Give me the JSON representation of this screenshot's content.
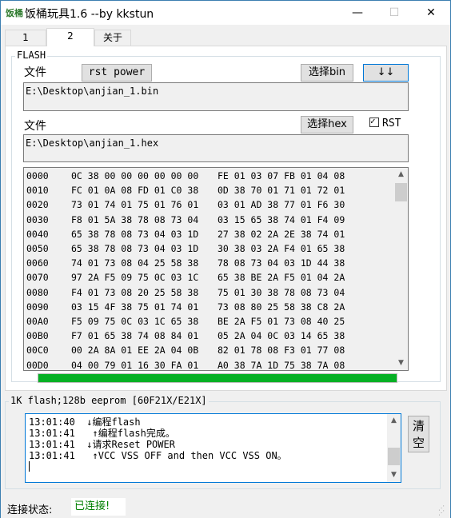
{
  "window": {
    "icon_label": "饭桶",
    "title": "饭桶玩具1.6    --by kkstun",
    "minimize": "—",
    "maximize": "☐",
    "close": "✕"
  },
  "tabs": [
    {
      "label": "1"
    },
    {
      "label": "2"
    },
    {
      "label": "关于"
    }
  ],
  "flash": {
    "group_label": "FLASH",
    "file_label_1": "文件",
    "file_label_2": "文件",
    "rst_power_button": "rst power",
    "select_bin_button": "选择bin",
    "arrow_button": "↓↓",
    "select_hex_button": "选择hex",
    "bin_path": "E:\\Desktop\\anjian_1.bin",
    "hex_path": "E:\\Desktop\\anjian_1.hex",
    "rst_checkbox_label": "RST",
    "rst_checked": true
  },
  "hex_rows": [
    {
      "addr": "0000",
      "left": "0C 38 00 00 00 00 00 00",
      "right": "FE 01 03 07 FB 01 04 08"
    },
    {
      "addr": "0010",
      "left": "FC 01 0A 08 FD 01 C0 38",
      "right": "0D 38 70 01 71 01 72 01"
    },
    {
      "addr": "0020",
      "left": "73 01 74 01 75 01 76 01",
      "right": "03 01 AD 38 77 01 F6 30"
    },
    {
      "addr": "0030",
      "left": "F8 01 5A 38 78 08 73 04",
      "right": "03 15 65 38 74 01 F4 09"
    },
    {
      "addr": "0040",
      "left": "65 38 78 08 73 04 03 1D",
      "right": "27 38 02 2A 2E 38 74 01"
    },
    {
      "addr": "0050",
      "left": "65 38 78 08 73 04 03 1D",
      "right": "30 38 03 2A F4 01 65 38"
    },
    {
      "addr": "0060",
      "left": "74 01 73 08 04 25 58 38",
      "right": "78 08 73 04 03 1D 44 38"
    },
    {
      "addr": "0070",
      "left": "97 2A F5 09 75 0C 03 1C",
      "right": "65 38 BE 2A F5 01 04 2A"
    },
    {
      "addr": "0080",
      "left": "F4 01 73 08 20 25 58 38",
      "right": "75 01 30 38 78 08 73 04"
    },
    {
      "addr": "0090",
      "left": "03 15 4F 38 75 01 74 01",
      "right": "73 08 80 25 58 38 C8 2A"
    },
    {
      "addr": "00A0",
      "left": "F5 09 75 0C 03 1C 65 38",
      "right": "BE 2A F5 01 73 08 40 25"
    },
    {
      "addr": "00B0",
      "left": "F7 01 65 38 74 08 84 01",
      "right": "05 2A 04 0C 03 14 65 38"
    },
    {
      "addr": "00C0",
      "left": "00 2A 8A 01 EE 2A 04 0B",
      "right": "82 01 78 08 F3 01 77 08"
    },
    {
      "addr": "00D0",
      "left": "04 00 79 01 16 30 FA 01",
      "right": "A0 38 7A 1D 75 38 7A 08"
    }
  ],
  "progress_percent": 100,
  "chip_info": "1K flash;128b eeprom [60F21X/E21X]",
  "log": [
    {
      "time": "13:01:40",
      "indent": "  ",
      "arrow": "↓",
      "text": "编程flash"
    },
    {
      "time": "13:01:41",
      "indent": "   ",
      "arrow": "↑",
      "text": "编程flash完成。"
    },
    {
      "time": "13:01:41",
      "indent": "  ",
      "arrow": "↓",
      "text": "请求Reset POWER"
    },
    {
      "time": "13:01:41",
      "indent": "   ",
      "arrow": "↑",
      "text": "VCC VSS OFF and then VCC VSS ON。"
    }
  ],
  "clear_button": "清空",
  "status": {
    "label": "连接状态:",
    "value": "已连接!"
  },
  "colors": {
    "progress": "#06b025",
    "connected": "#008000",
    "focus_border": "#0078d7"
  }
}
